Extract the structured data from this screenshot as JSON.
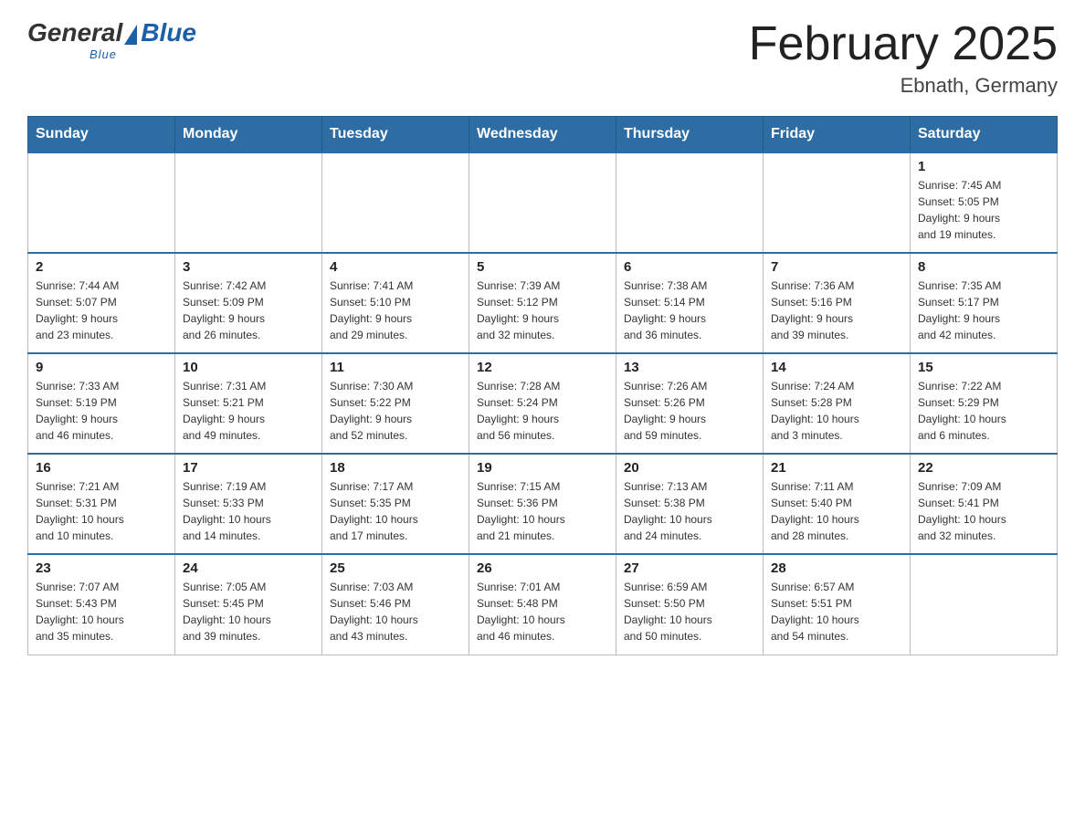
{
  "header": {
    "logo": {
      "general": "General",
      "blue": "Blue",
      "underline": "Blue"
    },
    "title": "February 2025",
    "location": "Ebnath, Germany"
  },
  "days_of_week": [
    "Sunday",
    "Monday",
    "Tuesday",
    "Wednesday",
    "Thursday",
    "Friday",
    "Saturday"
  ],
  "weeks": [
    [
      {
        "day": "",
        "info": ""
      },
      {
        "day": "",
        "info": ""
      },
      {
        "day": "",
        "info": ""
      },
      {
        "day": "",
        "info": ""
      },
      {
        "day": "",
        "info": ""
      },
      {
        "day": "",
        "info": ""
      },
      {
        "day": "1",
        "info": "Sunrise: 7:45 AM\nSunset: 5:05 PM\nDaylight: 9 hours\nand 19 minutes."
      }
    ],
    [
      {
        "day": "2",
        "info": "Sunrise: 7:44 AM\nSunset: 5:07 PM\nDaylight: 9 hours\nand 23 minutes."
      },
      {
        "day": "3",
        "info": "Sunrise: 7:42 AM\nSunset: 5:09 PM\nDaylight: 9 hours\nand 26 minutes."
      },
      {
        "day": "4",
        "info": "Sunrise: 7:41 AM\nSunset: 5:10 PM\nDaylight: 9 hours\nand 29 minutes."
      },
      {
        "day": "5",
        "info": "Sunrise: 7:39 AM\nSunset: 5:12 PM\nDaylight: 9 hours\nand 32 minutes."
      },
      {
        "day": "6",
        "info": "Sunrise: 7:38 AM\nSunset: 5:14 PM\nDaylight: 9 hours\nand 36 minutes."
      },
      {
        "day": "7",
        "info": "Sunrise: 7:36 AM\nSunset: 5:16 PM\nDaylight: 9 hours\nand 39 minutes."
      },
      {
        "day": "8",
        "info": "Sunrise: 7:35 AM\nSunset: 5:17 PM\nDaylight: 9 hours\nand 42 minutes."
      }
    ],
    [
      {
        "day": "9",
        "info": "Sunrise: 7:33 AM\nSunset: 5:19 PM\nDaylight: 9 hours\nand 46 minutes."
      },
      {
        "day": "10",
        "info": "Sunrise: 7:31 AM\nSunset: 5:21 PM\nDaylight: 9 hours\nand 49 minutes."
      },
      {
        "day": "11",
        "info": "Sunrise: 7:30 AM\nSunset: 5:22 PM\nDaylight: 9 hours\nand 52 minutes."
      },
      {
        "day": "12",
        "info": "Sunrise: 7:28 AM\nSunset: 5:24 PM\nDaylight: 9 hours\nand 56 minutes."
      },
      {
        "day": "13",
        "info": "Sunrise: 7:26 AM\nSunset: 5:26 PM\nDaylight: 9 hours\nand 59 minutes."
      },
      {
        "day": "14",
        "info": "Sunrise: 7:24 AM\nSunset: 5:28 PM\nDaylight: 10 hours\nand 3 minutes."
      },
      {
        "day": "15",
        "info": "Sunrise: 7:22 AM\nSunset: 5:29 PM\nDaylight: 10 hours\nand 6 minutes."
      }
    ],
    [
      {
        "day": "16",
        "info": "Sunrise: 7:21 AM\nSunset: 5:31 PM\nDaylight: 10 hours\nand 10 minutes."
      },
      {
        "day": "17",
        "info": "Sunrise: 7:19 AM\nSunset: 5:33 PM\nDaylight: 10 hours\nand 14 minutes."
      },
      {
        "day": "18",
        "info": "Sunrise: 7:17 AM\nSunset: 5:35 PM\nDaylight: 10 hours\nand 17 minutes."
      },
      {
        "day": "19",
        "info": "Sunrise: 7:15 AM\nSunset: 5:36 PM\nDaylight: 10 hours\nand 21 minutes."
      },
      {
        "day": "20",
        "info": "Sunrise: 7:13 AM\nSunset: 5:38 PM\nDaylight: 10 hours\nand 24 minutes."
      },
      {
        "day": "21",
        "info": "Sunrise: 7:11 AM\nSunset: 5:40 PM\nDaylight: 10 hours\nand 28 minutes."
      },
      {
        "day": "22",
        "info": "Sunrise: 7:09 AM\nSunset: 5:41 PM\nDaylight: 10 hours\nand 32 minutes."
      }
    ],
    [
      {
        "day": "23",
        "info": "Sunrise: 7:07 AM\nSunset: 5:43 PM\nDaylight: 10 hours\nand 35 minutes."
      },
      {
        "day": "24",
        "info": "Sunrise: 7:05 AM\nSunset: 5:45 PM\nDaylight: 10 hours\nand 39 minutes."
      },
      {
        "day": "25",
        "info": "Sunrise: 7:03 AM\nSunset: 5:46 PM\nDaylight: 10 hours\nand 43 minutes."
      },
      {
        "day": "26",
        "info": "Sunrise: 7:01 AM\nSunset: 5:48 PM\nDaylight: 10 hours\nand 46 minutes."
      },
      {
        "day": "27",
        "info": "Sunrise: 6:59 AM\nSunset: 5:50 PM\nDaylight: 10 hours\nand 50 minutes."
      },
      {
        "day": "28",
        "info": "Sunrise: 6:57 AM\nSunset: 5:51 PM\nDaylight: 10 hours\nand 54 minutes."
      },
      {
        "day": "",
        "info": ""
      }
    ]
  ]
}
